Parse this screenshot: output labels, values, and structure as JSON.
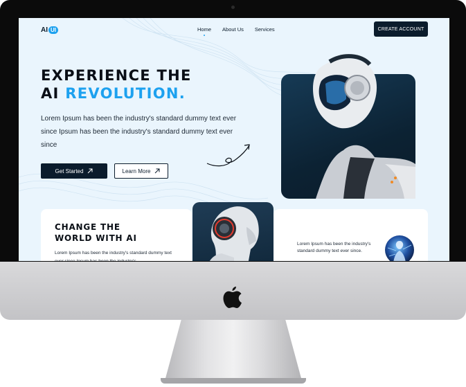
{
  "nav": {
    "logo_text": "AI",
    "logo_pill": "UI",
    "links": [
      "Home",
      "About Us",
      "Services"
    ],
    "cta": "CREATE ACCOUNT"
  },
  "hero": {
    "title_line1": "EXPERIENCE THE",
    "title_line2_plain": "AI ",
    "title_line2_accent": "REVOLUTION.",
    "description": "Lorem Ipsum has been the industry's standard dummy text ever since  Ipsum has been the industry's standard dummy text ever since",
    "primary_button": "Get Started",
    "secondary_button": "Learn More"
  },
  "feature_left": {
    "title_line1": "CHANGE THE",
    "title_line2": "WORLD WITH AI",
    "text": "Lorem Ipsum has been the industry's standard dummy text ever since  Ipsum has been the industry's"
  },
  "feature_right": {
    "text": "Lorem Ipsum has been the industry's standard dummy text ever since."
  },
  "colors": {
    "accent": "#1da1ef",
    "dark": "#0b1c2c",
    "screen_bg": "#eaf5fd"
  },
  "icons": [
    "apple-logo-icon",
    "arrow-up-right-icon",
    "curly-arrow-icon"
  ]
}
